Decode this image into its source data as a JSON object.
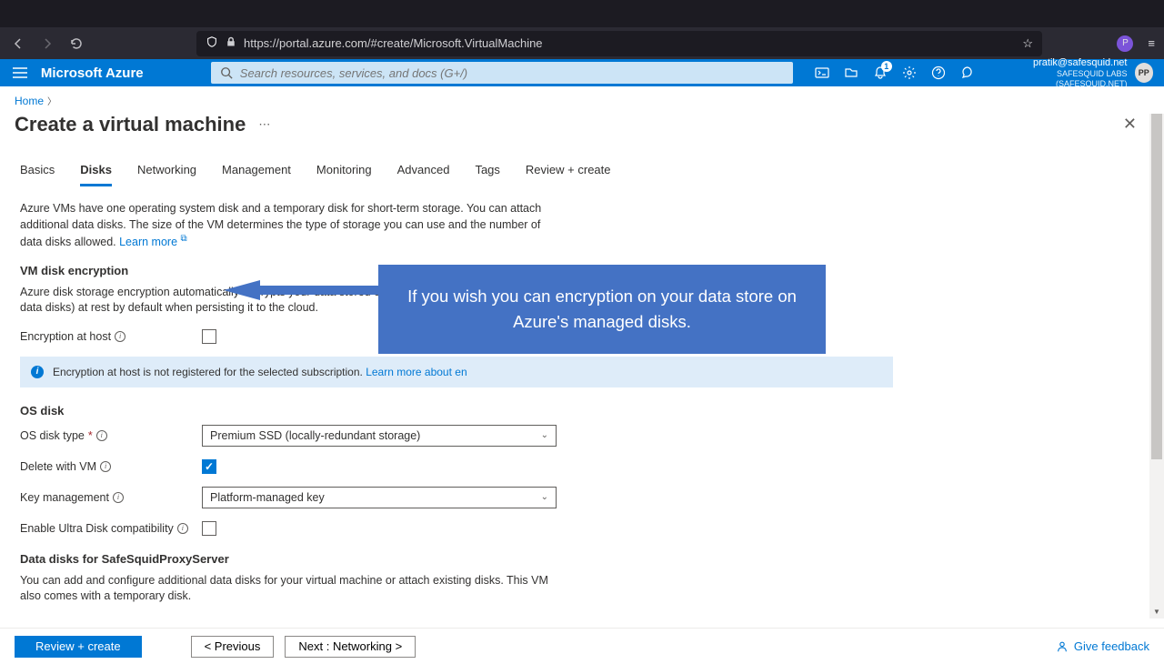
{
  "browser": {
    "url_prefix": "https://portal.",
    "url_domain": "azure.com",
    "url_path": "/#create/Microsoft.VirtualMachine"
  },
  "azure": {
    "brand": "Microsoft Azure",
    "search_placeholder": "Search resources, services, and docs (G+/)",
    "notif_count": "1",
    "account_email": "pratik@safesquid.net",
    "account_org": "SAFESQUID LABS (SAFESQUID.NET)",
    "avatar_initials": "PP"
  },
  "breadcrumb": {
    "home": "Home"
  },
  "page_title": "Create a virtual machine",
  "tabs": [
    {
      "label": "Basics",
      "active": false
    },
    {
      "label": "Disks",
      "active": true
    },
    {
      "label": "Networking",
      "active": false
    },
    {
      "label": "Management",
      "active": false
    },
    {
      "label": "Monitoring",
      "active": false
    },
    {
      "label": "Advanced",
      "active": false
    },
    {
      "label": "Tags",
      "active": false
    },
    {
      "label": "Review + create",
      "active": false
    }
  ],
  "intro_text": "Azure VMs have one operating system disk and a temporary disk for short-term storage. You can attach additional data disks. The size of the VM determines the type of storage you can use and the number of data disks allowed.",
  "learn_more": "Learn more",
  "section_encryption": {
    "heading": "VM disk encryption",
    "desc": "Azure disk storage encryption automatically encrypts your data stored on Azure managed disks (OS and data disks) at rest by default when persisting it to the cloud.",
    "field_label": "Encryption at host"
  },
  "info_banner": {
    "text": "Encryption at host is not registered for the selected subscription.",
    "link": "Learn more about en"
  },
  "callout_text": "If you wish you can encryption on your data store on Azure's managed disks.",
  "section_os": {
    "heading": "OS disk",
    "os_disk_type_label": "OS disk type",
    "os_disk_type_value": "Premium SSD (locally-redundant storage)",
    "delete_label": "Delete with VM",
    "key_mgmt_label": "Key management",
    "key_mgmt_value": "Platform-managed key",
    "ultra_label": "Enable Ultra Disk compatibility"
  },
  "section_data": {
    "heading": "Data disks for SafeSquidProxyServer",
    "desc": "You can add and configure additional data disks for your virtual machine or attach existing disks. This VM also comes with a temporary disk."
  },
  "footer": {
    "review": "Review + create",
    "previous": "<  Previous",
    "next": "Next : Networking  >",
    "feedback": "Give feedback"
  }
}
